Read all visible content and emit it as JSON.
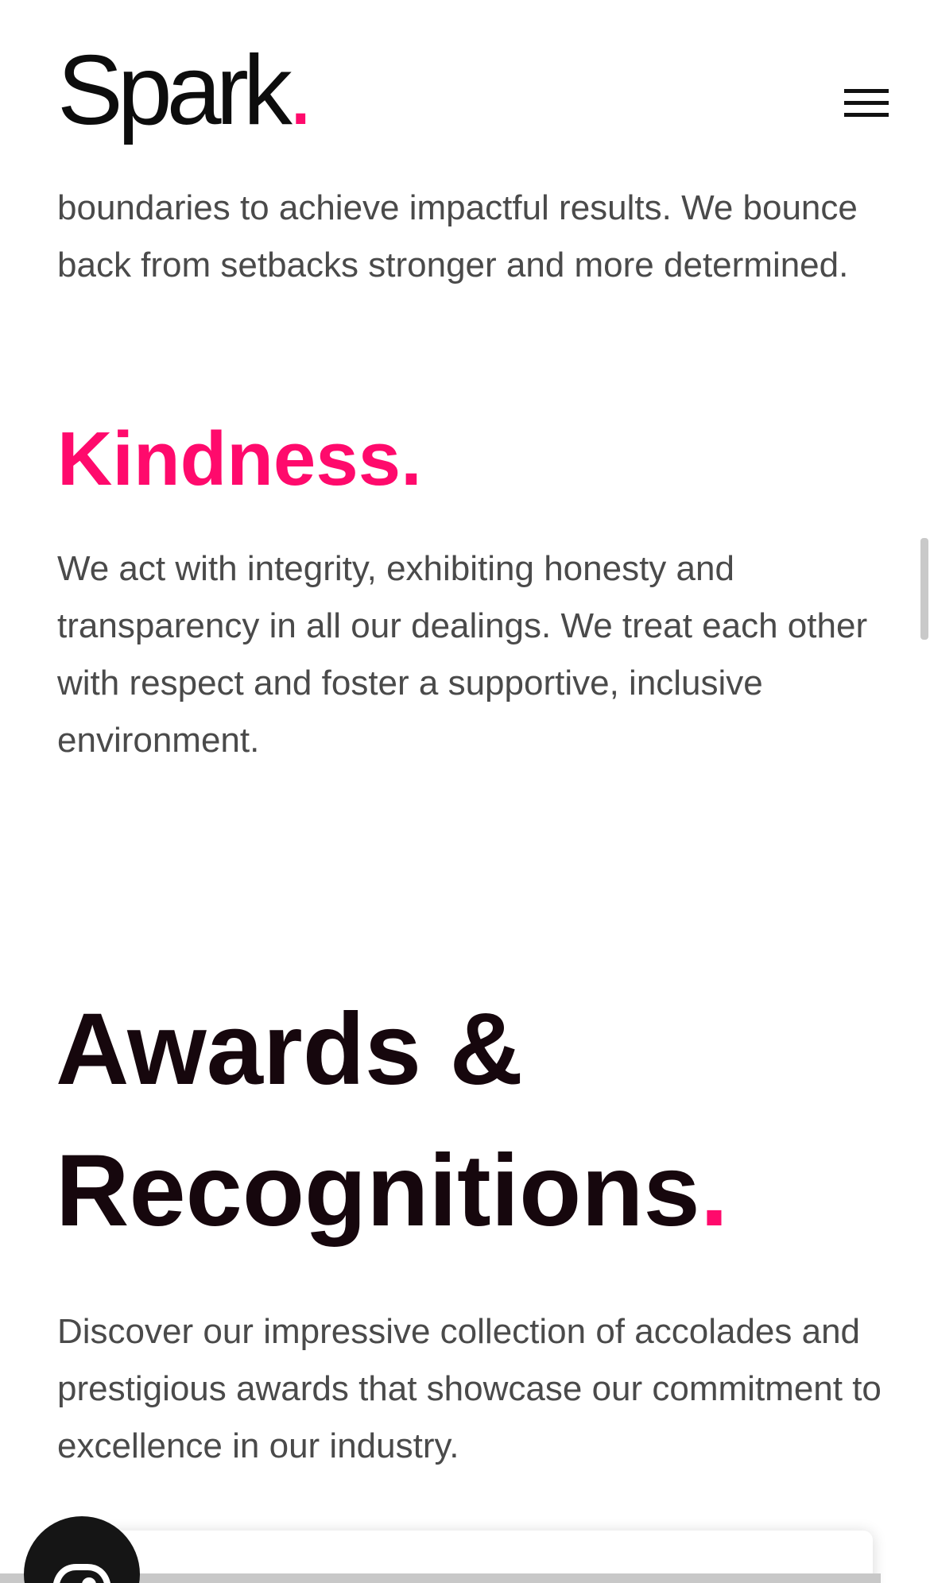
{
  "header": {
    "logo_text": "Spark",
    "logo_dot": "."
  },
  "values": {
    "clipped_paragraph": "boundaries to achieve impactful results. We bounce back from setbacks stronger and more determined.",
    "kindness": {
      "title": "Kindness",
      "dot": ".",
      "text": "We act with integrity, exhibiting honesty and transparency in all our dealings. We treat each other with respect and foster a supportive, inclusive environment."
    }
  },
  "awards": {
    "title_line1": "Awards &",
    "title_line2": "Recognitions",
    "dot": ".",
    "description": "Discover our impressive collection of accolades and prestigious awards that showcase our commitment to excellence in our industry."
  },
  "icons": {
    "menu": "hamburger-menu-icon",
    "chat": "chat-icon"
  },
  "colors": {
    "accent": "#ff0a6c",
    "heading": "#16070d",
    "body_text": "#4a4a4a",
    "fab_background": "#151515"
  }
}
